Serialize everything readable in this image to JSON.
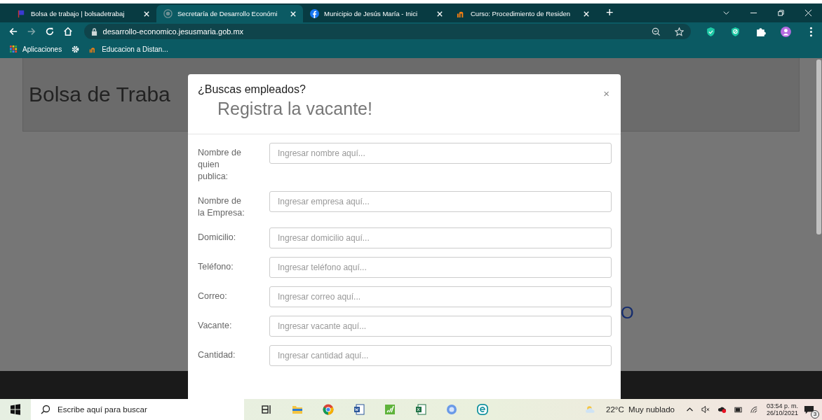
{
  "browser": {
    "tabs": [
      {
        "title": "Bolsa de trabajo | bolsadetrabaj",
        "selected": false
      },
      {
        "title": "Secretaría de Desarrollo Económi",
        "selected": true
      },
      {
        "title": "Municipio de Jesús María - Inici",
        "selected": false
      },
      {
        "title": "Curso: Procedimiento de Residen",
        "selected": false
      }
    ],
    "new_tab": "+",
    "url": "desarrollo-economico.jesusmaria.gob.mx",
    "bookmarks": [
      "Aplicaciones",
      "Educacion a Distan..."
    ]
  },
  "page": {
    "heading": "Bolsa de Traba",
    "partial_text": "O"
  },
  "modal": {
    "title": "¿Buscas empleados?",
    "subtitle": "Registra la vacante!",
    "close": "×",
    "fields": [
      {
        "label": "Nombre de quien publica:",
        "placeholder": "Ingresar nombre aquí..."
      },
      {
        "label": "Nombre de la Empresa:",
        "placeholder": "Ingresar empresa aquí..."
      },
      {
        "label": "Domicilio:",
        "placeholder": "Ingresar domicilio aquí..."
      },
      {
        "label": "Teléfono:",
        "placeholder": "Ingresar teléfono aquí..."
      },
      {
        "label": "Correo:",
        "placeholder": "Ingresar correo aquí..."
      },
      {
        "label": "Vacante:",
        "placeholder": "Ingresar vacante aquí..."
      },
      {
        "label": "Cantidad:",
        "placeholder": "Ingresar cantidad aquí..."
      }
    ]
  },
  "taskbar": {
    "search_placeholder": "Escribe aquí para buscar",
    "weather": "22°C  Muy nublado",
    "time": "03:54 p. m.",
    "date": "26/10/2021",
    "notifications": "3"
  }
}
